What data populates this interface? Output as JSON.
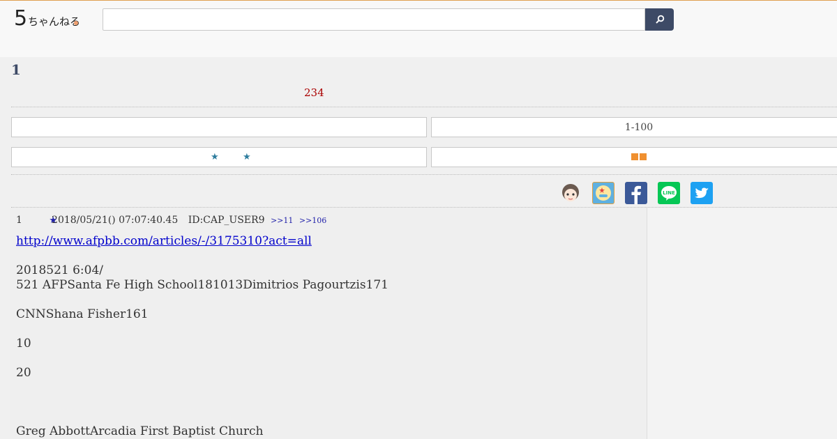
{
  "header": {
    "logo_big": "5",
    "logo_small": "ちゃんねる",
    "search_value": "",
    "search_placeholder": ""
  },
  "thread": {
    "title": "1",
    "count": "234"
  },
  "nav": {
    "left_top": "",
    "right_top": "1-100",
    "left_bottom_star": "★",
    "right_bottom": "■■"
  },
  "share_icons": [
    "character-icon",
    "app-icon",
    "facebook-icon",
    "line-icon",
    "twitter-icon"
  ],
  "post": {
    "number": "1",
    "name_star": "★",
    "date": "2018/05/21() 07:07:40.45",
    "id": "ID:CAP_USER9",
    "anchors": [
      ">>11",
      ">>106"
    ],
    "link": "http://www.afpbb.com/articles/-/3175310?act=all",
    "lines": [
      "",
      "2018521 6:04/",
      "521 AFPSanta Fe High School181013Dimitrios Pagourtzis171",
      "",
      "CNNShana Fisher161",
      "",
      "10",
      "",
      "20",
      "",
      "",
      "",
      "Greg AbbottArcadia First Baptist Church"
    ]
  },
  "colors": {
    "accent": "#3d4a66",
    "count_red": "#aa0000",
    "link_blue": "#0000cc",
    "facebook": "#3b5998",
    "line": "#06c755",
    "twitter": "#1da1f2"
  }
}
